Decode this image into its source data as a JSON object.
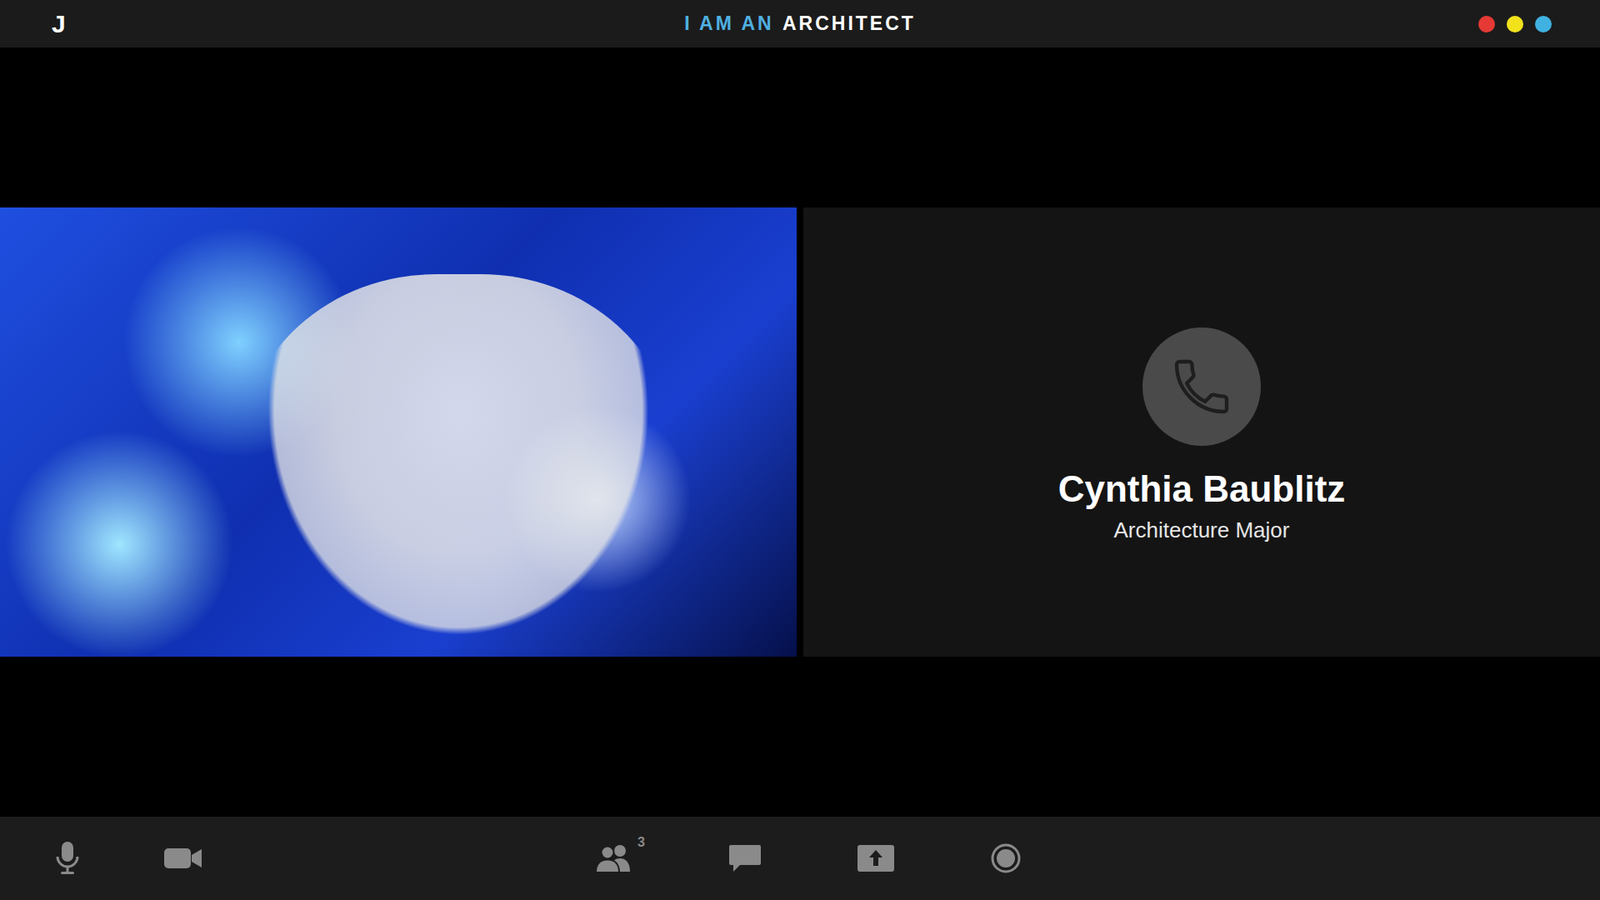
{
  "topbar": {
    "logo": "J",
    "title": [
      {
        "text": "I AM AN",
        "color": "#4fb0e0"
      },
      {
        "text": "ARCHITECT",
        "color": "#ffffff"
      }
    ],
    "dots": [
      {
        "color": "#e53935"
      },
      {
        "color": "#f2e21c"
      },
      {
        "color": "#3fb2e2"
      }
    ]
  },
  "tiles": [
    {
      "kind": "video"
    },
    {
      "kind": "audio",
      "name": "Cynthia Baublitz",
      "role": "Architecture Major"
    }
  ],
  "toolbar": [
    {
      "kind": "mic"
    },
    {
      "kind": "camera"
    },
    {
      "kind": "participants",
      "badge": "3"
    },
    {
      "kind": "chat"
    },
    {
      "kind": "share"
    },
    {
      "kind": "record"
    }
  ]
}
